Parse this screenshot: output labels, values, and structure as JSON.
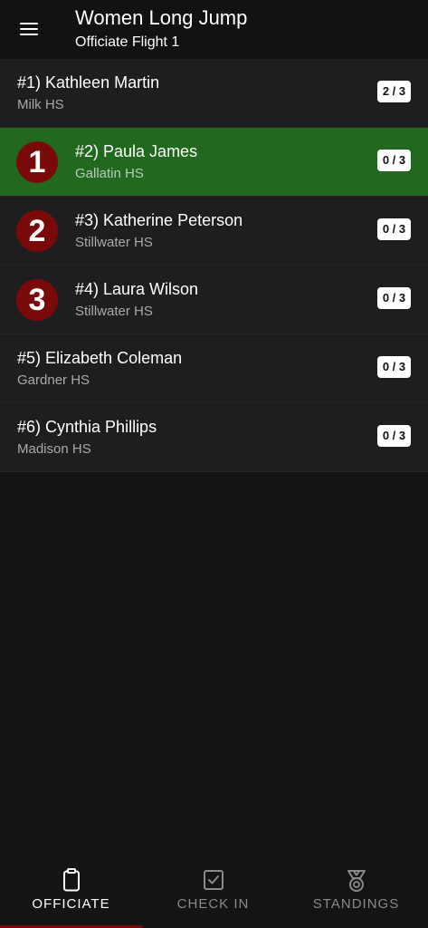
{
  "header": {
    "title": "Women Long Jump",
    "subtitle": "Officiate Flight 1",
    "menu_icon": "hamburger-menu-icon"
  },
  "athletes": [
    {
      "name": "#1) Kathleen Martin",
      "school": "Milk HS",
      "attempts": "2 / 3",
      "rank": null,
      "active": false
    },
    {
      "name": "#2) Paula James",
      "school": "Gallatin HS",
      "attempts": "0 / 3",
      "rank": "1",
      "active": true
    },
    {
      "name": "#3) Katherine Peterson",
      "school": "Stillwater HS",
      "attempts": "0 / 3",
      "rank": "2",
      "active": false
    },
    {
      "name": "#4) Laura Wilson",
      "school": "Stillwater HS",
      "attempts": "0 / 3",
      "rank": "3",
      "active": false
    },
    {
      "name": "#5) Elizabeth Coleman",
      "school": "Gardner HS",
      "attempts": "0 / 3",
      "rank": null,
      "active": false
    },
    {
      "name": "#6) Cynthia Phillips",
      "school": "Madison HS",
      "attempts": "0 / 3",
      "rank": null,
      "active": false
    }
  ],
  "bottom_nav": {
    "items": [
      {
        "label": "OFFICIATE",
        "icon": "clipboard-icon",
        "active": true
      },
      {
        "label": "CHECK IN",
        "icon": "checkbox-icon",
        "active": false
      },
      {
        "label": "STANDINGS",
        "icon": "medal-icon",
        "active": false
      }
    ]
  },
  "colors": {
    "active_row": "#21691f",
    "rank_badge": "#7a0a0a",
    "background": "#131313",
    "row_background": "#1e1e20"
  }
}
